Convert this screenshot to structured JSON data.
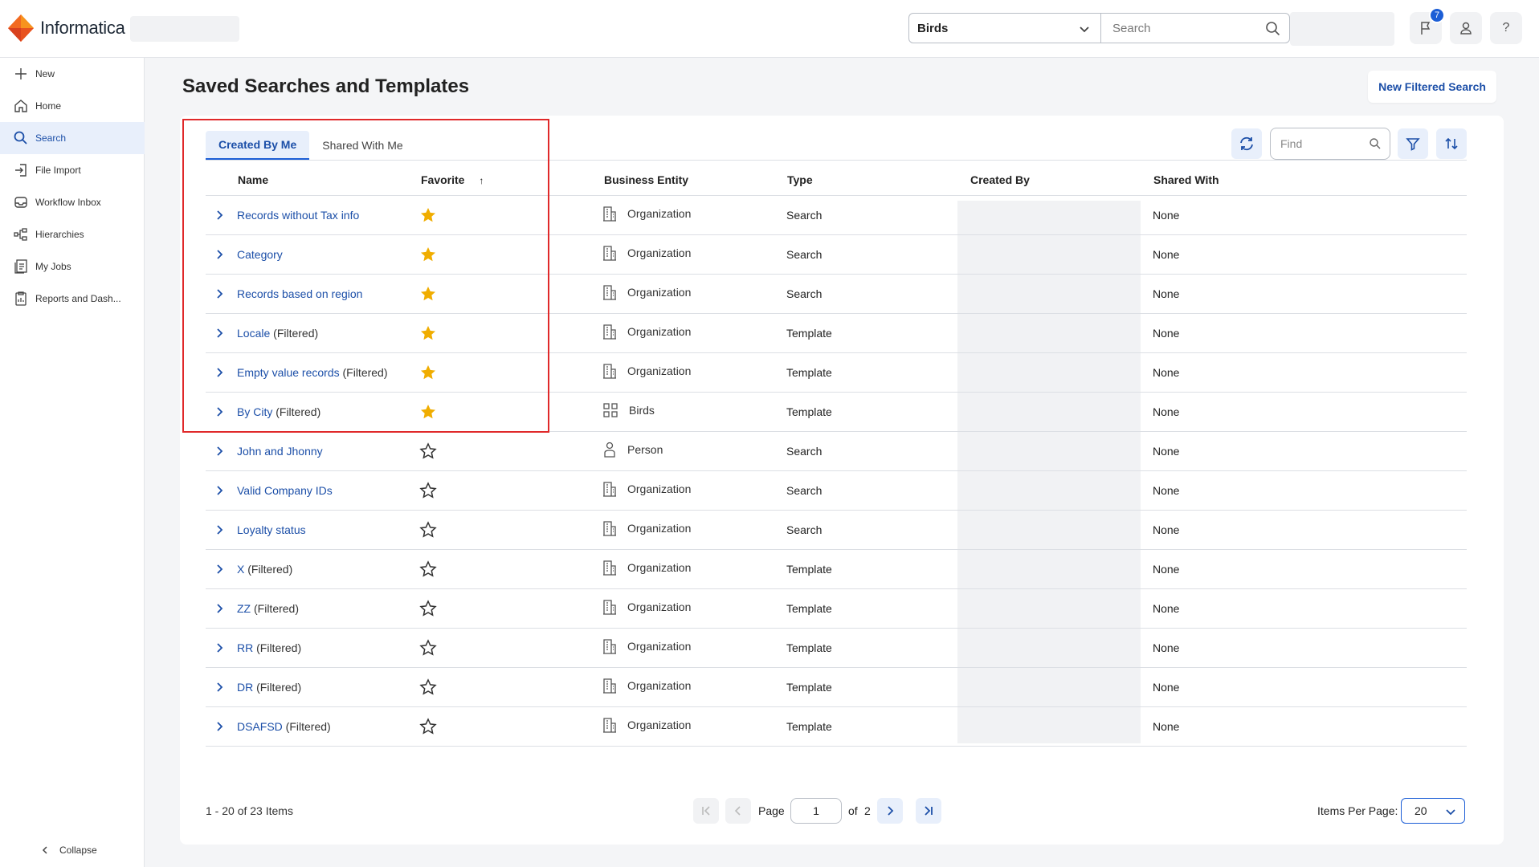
{
  "app": {
    "brand": "Informatica",
    "accent": "#1c5ed6",
    "link_color": "#1c4fa8",
    "highlight_color": "#e0292a",
    "star_color": "#f0ad00"
  },
  "header": {
    "entity_select": "Birds",
    "search_placeholder": "Search",
    "notifications_count": "7",
    "help_label": "?"
  },
  "sidebar": {
    "items": [
      {
        "label": "New",
        "icon": "plus-icon"
      },
      {
        "label": "Home",
        "icon": "home-icon"
      },
      {
        "label": "Search",
        "icon": "search-icon"
      },
      {
        "label": "File Import",
        "icon": "file-import-icon"
      },
      {
        "label": "Workflow Inbox",
        "icon": "inbox-icon"
      },
      {
        "label": "Hierarchies",
        "icon": "hierarchy-icon"
      },
      {
        "label": "My Jobs",
        "icon": "jobs-icon"
      },
      {
        "label": "Reports and Dash...",
        "icon": "reports-icon"
      }
    ],
    "active": "Search",
    "collapse_label": "Collapse"
  },
  "page": {
    "title": "Saved Searches and Templates",
    "new_filtered_search": "New Filtered Search",
    "tabs": [
      "Created By Me",
      "Shared With Me"
    ],
    "active_tab": "Created By Me",
    "find_placeholder": "Find"
  },
  "table": {
    "columns": [
      "Name",
      "Favorite",
      "Business Entity",
      "Type",
      "Created By",
      "Shared With"
    ],
    "sort_indicator": "↑",
    "rows": [
      {
        "name": "Records without Tax info",
        "suffix": "",
        "favorite": true,
        "entity": "Organization",
        "entity_icon": "building-icon",
        "type": "Search",
        "shared_with": "None"
      },
      {
        "name": "Category",
        "suffix": "",
        "favorite": true,
        "entity": "Organization",
        "entity_icon": "building-icon",
        "type": "Search",
        "shared_with": "None"
      },
      {
        "name": "Records based on region",
        "suffix": "",
        "favorite": true,
        "entity": "Organization",
        "entity_icon": "building-icon",
        "type": "Search",
        "shared_with": "None"
      },
      {
        "name": "Locale",
        "suffix": " (Filtered)",
        "favorite": true,
        "entity": "Organization",
        "entity_icon": "building-icon",
        "type": "Template",
        "shared_with": "None"
      },
      {
        "name": "Empty value records",
        "suffix": " (Filtered)",
        "favorite": true,
        "entity": "Organization",
        "entity_icon": "building-icon",
        "type": "Template",
        "shared_with": "None"
      },
      {
        "name": "By City",
        "suffix": " (Filtered)",
        "favorite": true,
        "entity": "Birds",
        "entity_icon": "grid-icon",
        "type": "Template",
        "shared_with": "None"
      },
      {
        "name": "John and Jhonny",
        "suffix": "",
        "favorite": false,
        "entity": "Person",
        "entity_icon": "person-icon",
        "type": "Search",
        "shared_with": "None"
      },
      {
        "name": "Valid Company IDs",
        "suffix": "",
        "favorite": false,
        "entity": "Organization",
        "entity_icon": "building-icon",
        "type": "Search",
        "shared_with": "None"
      },
      {
        "name": "Loyalty status",
        "suffix": "",
        "favorite": false,
        "entity": "Organization",
        "entity_icon": "building-icon",
        "type": "Search",
        "shared_with": "None"
      },
      {
        "name": "X",
        "suffix": " (Filtered)",
        "favorite": false,
        "entity": "Organization",
        "entity_icon": "building-icon",
        "type": "Template",
        "shared_with": "None"
      },
      {
        "name": "ZZ",
        "suffix": " (Filtered)",
        "favorite": false,
        "entity": "Organization",
        "entity_icon": "building-icon",
        "type": "Template",
        "shared_with": "None"
      },
      {
        "name": "RR",
        "suffix": " (Filtered)",
        "favorite": false,
        "entity": "Organization",
        "entity_icon": "building-icon",
        "type": "Template",
        "shared_with": "None"
      },
      {
        "name": "DR",
        "suffix": " (Filtered)",
        "favorite": false,
        "entity": "Organization",
        "entity_icon": "building-icon",
        "type": "Template",
        "shared_with": "None"
      },
      {
        "name": "DSAFSD",
        "suffix": " (Filtered)",
        "favorite": false,
        "entity": "Organization",
        "entity_icon": "building-icon",
        "type": "Template",
        "shared_with": "None"
      }
    ]
  },
  "footer": {
    "count_text": "1 - 20 of 23 Items",
    "page_label": "Page",
    "page_value": "1",
    "of_label": "of",
    "total_pages": "2",
    "items_per_page_label": "Items Per Page:",
    "items_per_page": "20"
  }
}
